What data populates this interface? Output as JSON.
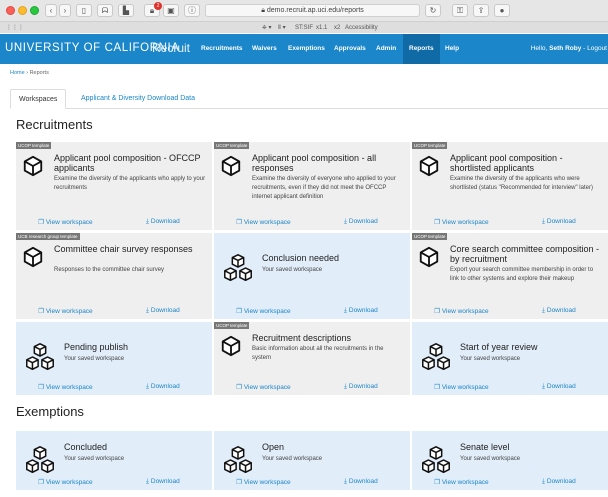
{
  "browser": {
    "url": "demo.recruit.ap.uci.edu/reports",
    "notification_count": "2",
    "toolbar_text": "ST:SIF",
    "toolbar_zoom": "x1.1",
    "toolbar_scale": "x2",
    "toolbar_accessibility": "Accessibility"
  },
  "nav": {
    "brand": "UNIVERSITY OF CALIFORNIA",
    "app_name": "Recruit",
    "links": [
      "Recruitments",
      "Waivers",
      "Exemptions",
      "Approvals",
      "Admin",
      "Reports",
      "Help"
    ],
    "active_link": "Reports",
    "greeting": "Hello,",
    "user": "Seth Roby",
    "logout": "- Logout"
  },
  "breadcrumb": {
    "home": "Home",
    "separator": "›",
    "current": "Reports"
  },
  "tabs": [
    "Workspaces",
    "Applicant & Diversity Download Data"
  ],
  "actions": {
    "view": "View workspace",
    "download": "Download"
  },
  "sections": [
    {
      "title": "Recruitments",
      "cards": [
        {
          "tag": "UCOP template",
          "title": "Applicant pool composition - OFCCP applicants",
          "desc": "Examine the diversity of the applicants who apply to your recruitments",
          "style": "report"
        },
        {
          "tag": "UCOP template",
          "title": "Applicant pool composition - all responses",
          "desc": "Examine the diversity of everyone who applied to your recruitments, even if they did not meet the OFCCP internet applicant definition",
          "style": "report"
        },
        {
          "tag": "UCOP template",
          "title": "Applicant pool composition - shortlisted applicants",
          "desc": "Examine the diversity of the applicants who were shortlisted (status \"Recommended for interview\" later)",
          "style": "report"
        },
        {
          "tag": "UCB research group template",
          "title": "Committee chair survey responses",
          "desc": "Responses to the committee chair survey",
          "style": "report"
        },
        {
          "tag": "",
          "title": "Conclusion needed",
          "desc": "Your saved workspace",
          "style": "saved"
        },
        {
          "tag": "UCOP template",
          "title": "Core search committee composition - by recruitment",
          "desc": "Export your search committee membership in order to link to other systems and explore their makeup",
          "style": "report"
        },
        {
          "tag": "",
          "title": "Pending publish",
          "desc": "Your saved workspace",
          "style": "saved"
        },
        {
          "tag": "UCOP template",
          "title": "Recruitment descriptions",
          "desc": "Basic information about all the recruitments in the system",
          "style": "report"
        },
        {
          "tag": "",
          "title": "Start of year review",
          "desc": "Your saved workspace",
          "style": "saved"
        }
      ]
    },
    {
      "title": "Exemptions",
      "cards": [
        {
          "tag": "",
          "title": "Concluded",
          "desc": "Your saved workspace",
          "style": "saved"
        },
        {
          "tag": "",
          "title": "Open",
          "desc": "Your saved workspace",
          "style": "saved"
        },
        {
          "tag": "",
          "title": "Senate level",
          "desc": "Your saved workspace",
          "style": "saved"
        }
      ]
    }
  ]
}
